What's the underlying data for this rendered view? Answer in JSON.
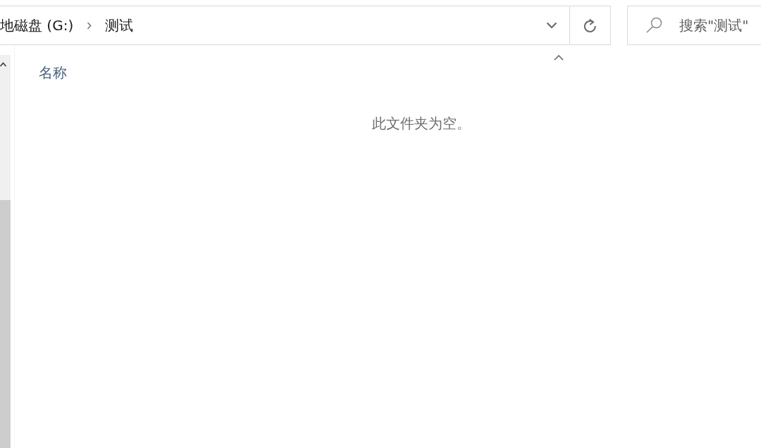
{
  "address_bar": {
    "path": [
      {
        "label": "地磁盘 (G:)"
      },
      {
        "label": "测试"
      }
    ]
  },
  "search": {
    "placeholder": "搜索\"测试\""
  },
  "file_list": {
    "columns": [
      {
        "label": "名称",
        "sorted_ascending": true
      }
    ],
    "empty_message": "此文件夹为空。"
  }
}
